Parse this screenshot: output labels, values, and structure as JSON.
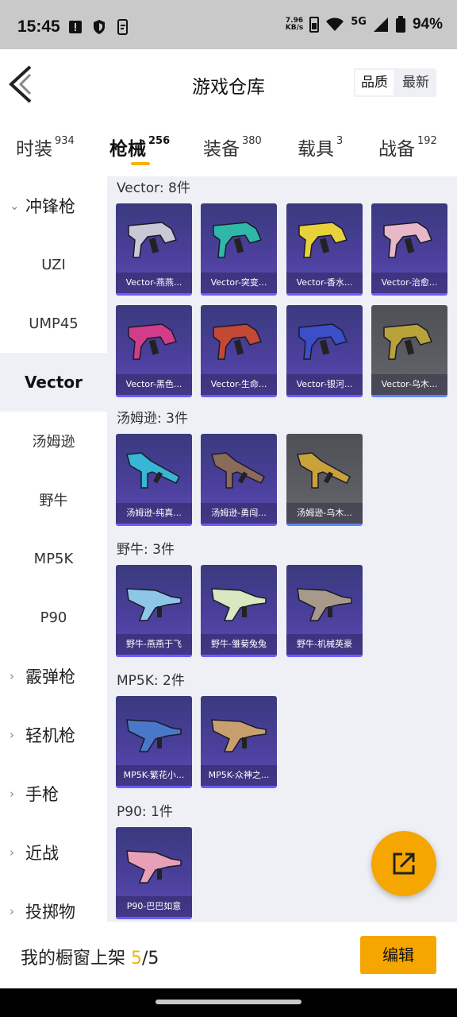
{
  "status_bar": {
    "time": "15:45",
    "net_speed_value": "7.96",
    "net_speed_unit": "KB/s",
    "network": "5G",
    "battery": "94%"
  },
  "header": {
    "title": "游戏仓库",
    "sort_options": [
      "品质",
      "最新"
    ],
    "active_sort": "品质"
  },
  "tabs": [
    {
      "label": "时装",
      "count": "934"
    },
    {
      "label": "枪械",
      "count": "256"
    },
    {
      "label": "装备",
      "count": "380"
    },
    {
      "label": "载具",
      "count": "3"
    },
    {
      "label": "战备",
      "count": "192"
    }
  ],
  "active_tab": "枪械",
  "sidebar": {
    "items": [
      {
        "label": "冲锋枪",
        "type": "category",
        "expanded": true
      },
      {
        "label": "UZI",
        "type": "sub"
      },
      {
        "label": "UMP45",
        "type": "sub"
      },
      {
        "label": "Vector",
        "type": "sub",
        "active": true
      },
      {
        "label": "汤姆逊",
        "type": "sub"
      },
      {
        "label": "野牛",
        "type": "sub"
      },
      {
        "label": "MP5K",
        "type": "sub"
      },
      {
        "label": "P90",
        "type": "sub"
      },
      {
        "label": "霰弹枪",
        "type": "category"
      },
      {
        "label": "轻机枪",
        "type": "category"
      },
      {
        "label": "手枪",
        "type": "category"
      },
      {
        "label": "近战",
        "type": "category"
      },
      {
        "label": "投掷物",
        "type": "category"
      }
    ]
  },
  "sections": [
    {
      "title": "Vector: 8件",
      "items": [
        {
          "label": "Vector-燕燕...",
          "color": "#c9c9d6",
          "style": "purple"
        },
        {
          "label": "Vector-突变...",
          "color": "#2fb8a8",
          "style": "purple"
        },
        {
          "label": "Vector-香水...",
          "color": "#e8d23a",
          "style": "purple"
        },
        {
          "label": "Vector-治愈...",
          "color": "#e7b8c8",
          "style": "purple"
        },
        {
          "label": "Vector-黑色...",
          "color": "#d23d8a",
          "style": "purple"
        },
        {
          "label": "Vector-生命...",
          "color": "#c44836",
          "style": "purple"
        },
        {
          "label": "Vector-银河...",
          "color": "#3a4fc8",
          "style": "purple"
        },
        {
          "label": "Vector-乌木...",
          "color": "#b8a23a",
          "style": "gray"
        }
      ]
    },
    {
      "title": "汤姆逊: 3件",
      "items": [
        {
          "label": "汤姆逊-纯真...",
          "color": "#38b6d6",
          "style": "purple"
        },
        {
          "label": "汤姆逊-勇闯...",
          "color": "#8a6a5a",
          "style": "purple"
        },
        {
          "label": "汤姆逊-乌木...",
          "color": "#c9a23a",
          "style": "gray"
        }
      ]
    },
    {
      "title": "野牛: 3件",
      "items": [
        {
          "label": "野牛-燕燕于飞",
          "color": "#8ec6e8",
          "style": "purple"
        },
        {
          "label": "野牛-雏菊兔兔",
          "color": "#d8e8c0",
          "style": "purple"
        },
        {
          "label": "野牛-机械英豪",
          "color": "#a89a8a",
          "style": "purple"
        }
      ]
    },
    {
      "title": "MP5K: 2件",
      "items": [
        {
          "label": "MP5K-繁花小...",
          "color": "#4a78c8",
          "style": "purple"
        },
        {
          "label": "MP5K-众神之...",
          "color": "#c8a070",
          "style": "purple"
        }
      ]
    },
    {
      "title": "P90: 1件",
      "items": [
        {
          "label": "P90-巴巴如意",
          "color": "#e8a0b8",
          "style": "purple"
        }
      ]
    }
  ],
  "bottom": {
    "showcase_label": "我的橱窗上架",
    "showcase_current": "5",
    "showcase_total": "/5",
    "edit_label": "编辑"
  },
  "colors": {
    "accent": "#f5a600",
    "rarity_purple": "#4a3f9a",
    "rarity_gray": "#5c5c63"
  }
}
